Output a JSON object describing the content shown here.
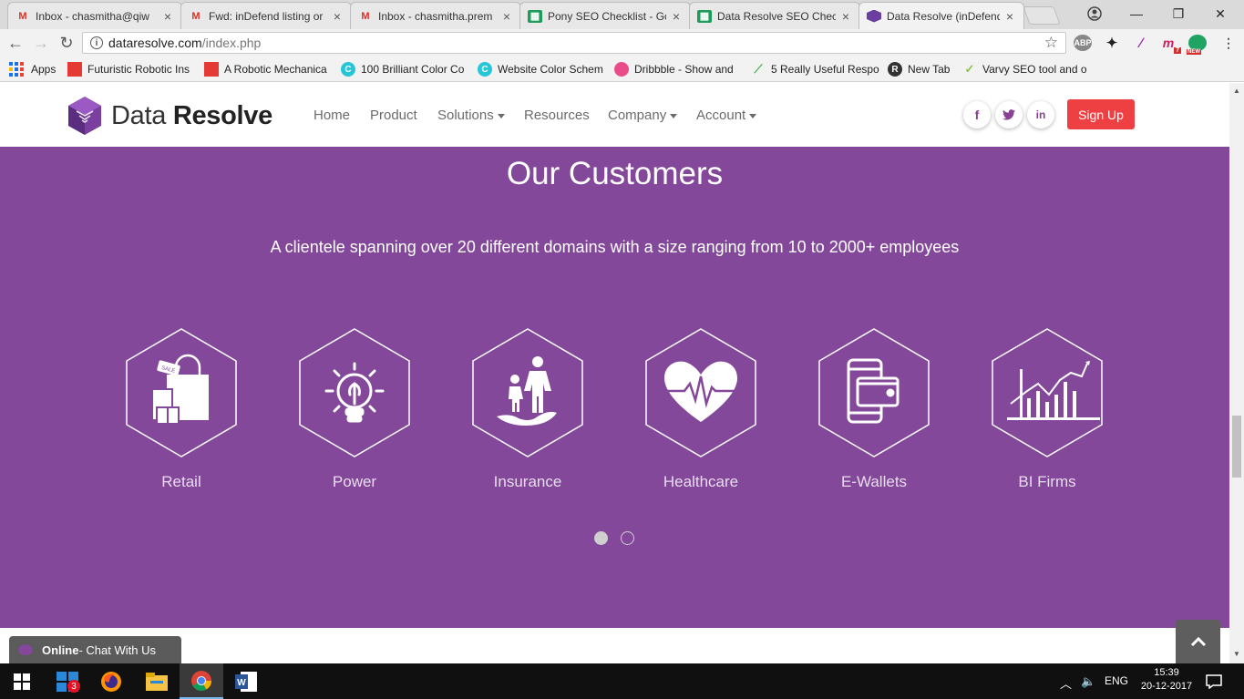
{
  "browser": {
    "tabs": [
      {
        "title": "Inbox - chasmitha@qiw",
        "icon": "gmail-icon"
      },
      {
        "title": "Fwd: inDefend listing or",
        "icon": "gmail-icon"
      },
      {
        "title": "Inbox - chasmitha.prem",
        "icon": "gmail-icon"
      },
      {
        "title": "Pony SEO Checklist - Go",
        "icon": "sheets-icon"
      },
      {
        "title": "Data Resolve SEO Chec",
        "icon": "sheets-icon"
      },
      {
        "title": "Data Resolve (inDefend",
        "icon": "dataresolve-icon"
      }
    ],
    "url_host": "dataresolve.com",
    "url_path": "/index.php",
    "extensions": {
      "abp": "ABP",
      "badge_count": "7",
      "new_badge": "NEW"
    },
    "bookmarks": [
      "Apps",
      "Futuristic Robotic Ins",
      "A Robotic Mechanica",
      "100 Brilliant Color Co",
      "Website Color Schem",
      "Dribbble - Show and",
      "5 Really Useful Respo",
      "New Tab",
      "Varvy SEO tool and o"
    ]
  },
  "header": {
    "logo_light": "Data ",
    "logo_bold": "Resolve",
    "nav": [
      {
        "label": "Home",
        "dropdown": false
      },
      {
        "label": "Product",
        "dropdown": false
      },
      {
        "label": "Solutions",
        "dropdown": true
      },
      {
        "label": "Resources",
        "dropdown": false
      },
      {
        "label": "Company",
        "dropdown": true
      },
      {
        "label": "Account",
        "dropdown": true
      }
    ],
    "social": {
      "facebook": "f",
      "twitter": "t",
      "linkedin": "in"
    },
    "signup": "Sign Up"
  },
  "customers": {
    "title": "Our Customers",
    "subtitle": "A clientele spanning over 20 different domains with a size ranging from 10 to 2000+ employees",
    "items": [
      {
        "label": "Retail",
        "icon": "shopping-bags-icon"
      },
      {
        "label": "Power",
        "icon": "lightbulb-icon"
      },
      {
        "label": "Insurance",
        "icon": "family-hand-icon"
      },
      {
        "label": "Healthcare",
        "icon": "heart-pulse-icon"
      },
      {
        "label": "E-Wallets",
        "icon": "phone-wallet-icon"
      },
      {
        "label": "BI Firms",
        "icon": "bar-chart-icon"
      }
    ],
    "carousel": {
      "pages": 2,
      "active": 1
    },
    "sale_tag": "SALE"
  },
  "chat": {
    "status": "Online",
    "label": " - Chat With Us"
  },
  "taskbar": {
    "store_badge": "3",
    "lang": "ENG",
    "time": "15:39",
    "date": "20-12-2017"
  },
  "colors": {
    "brand_purple": "#834899",
    "signup_red": "#ee3f43"
  }
}
